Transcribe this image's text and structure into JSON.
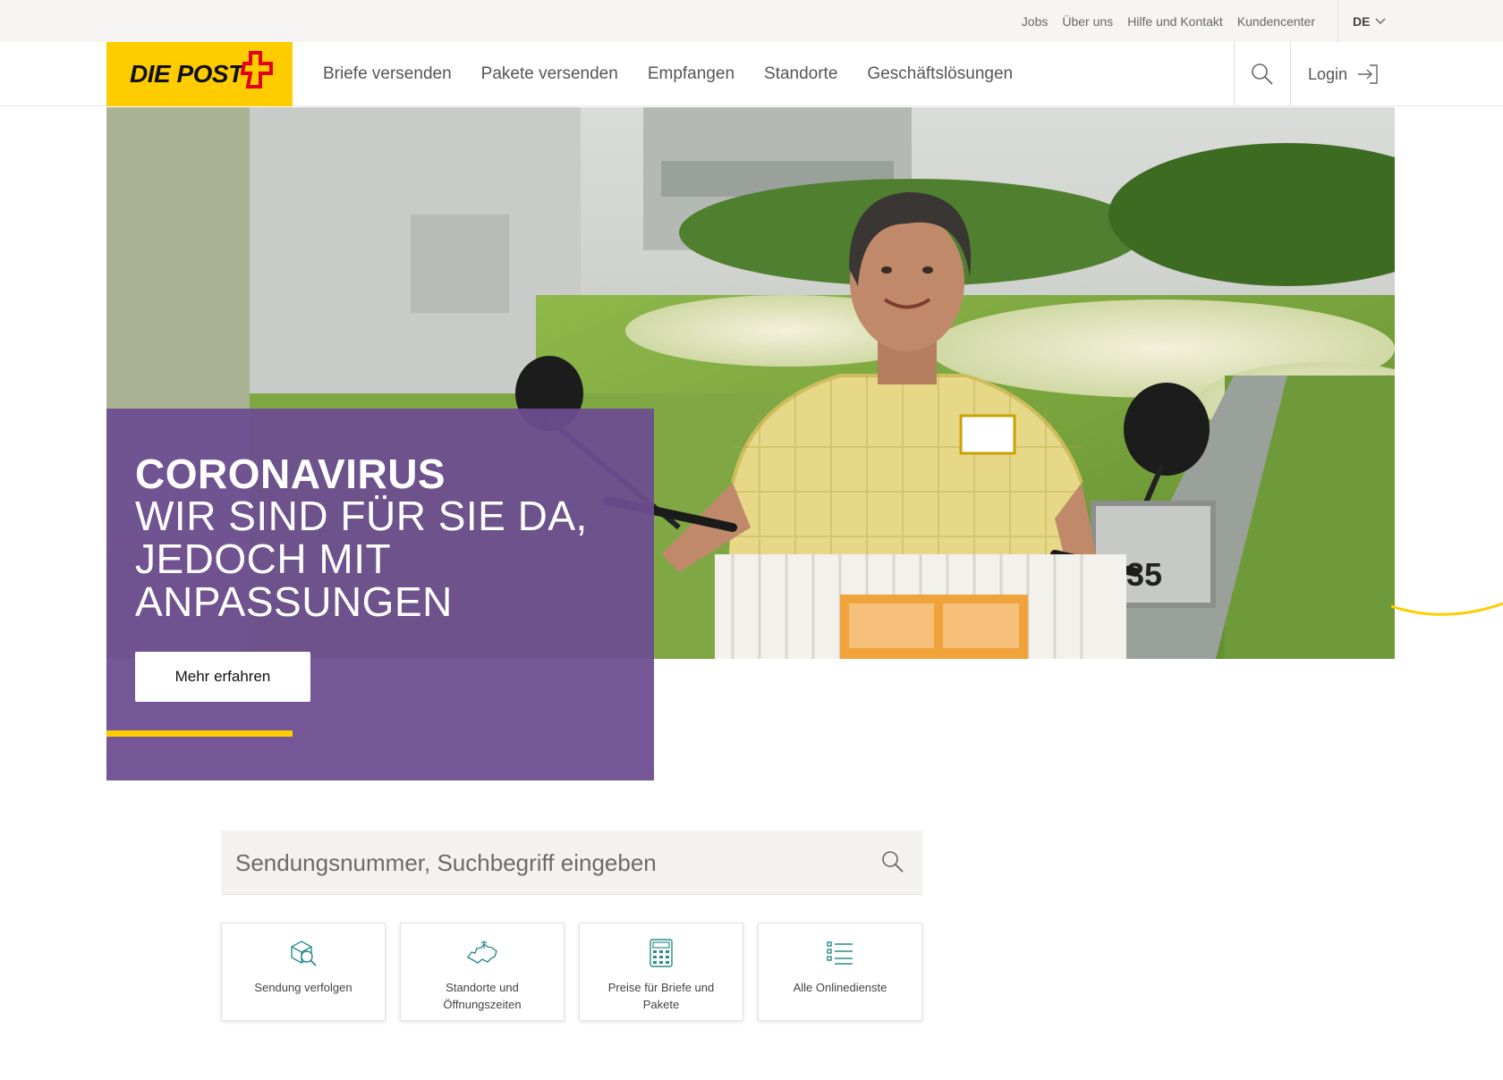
{
  "topbar": {
    "links": [
      "Jobs",
      "Über uns",
      "Hilfe und Kontakt",
      "Kundencenter"
    ],
    "language": "DE"
  },
  "brand": {
    "logo_text": "DIE POST",
    "colors": {
      "yellow": "#ffcc00",
      "red": "#e2001a",
      "purple": "#6c4d91"
    }
  },
  "mainnav": {
    "items": [
      "Briefe versenden",
      "Pakete versenden",
      "Empfangen",
      "Standorte",
      "Geschäftslösungen"
    ],
    "login_label": "Login"
  },
  "hero": {
    "title": "CORONAVIRUS",
    "subtitle": "WIR SIND FÜR SIE DA, JEDOCH MIT ANPASSUNGEN",
    "cta_label": "Mehr erfahren",
    "plate_number": "35"
  },
  "search": {
    "placeholder": "Sendungsnummer, Suchbegriff eingeben"
  },
  "tiles": [
    {
      "label": "Sendung verfolgen",
      "icon": "parcel-search-icon"
    },
    {
      "label": "Standorte und Öffnungszeiten",
      "icon": "switzerland-map-icon"
    },
    {
      "label": "Preise für Briefe und Pakete",
      "icon": "calculator-icon"
    },
    {
      "label": "Alle Onlinedienste",
      "icon": "list-icon"
    }
  ]
}
